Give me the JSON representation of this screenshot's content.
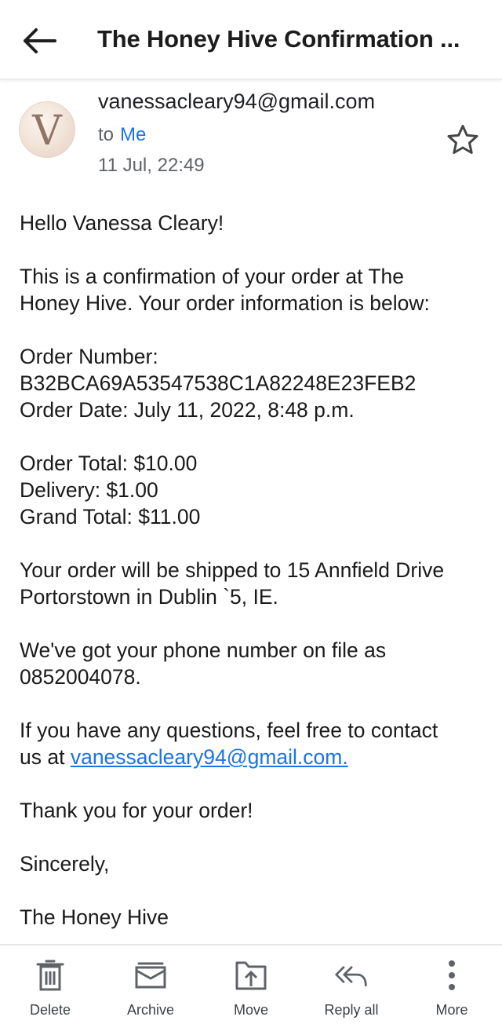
{
  "header": {
    "subject": "The Honey Hive Confirmation ...",
    "back_icon": "arrow-left-icon"
  },
  "message": {
    "avatar_letter": "V",
    "sender": "vanessacleary94@gmail.com",
    "to_label": "to",
    "recipient": "Me",
    "date": "11 Jul, 22:49",
    "star_icon": "star-outline-icon"
  },
  "body": {
    "greeting": "Hello Vanessa Cleary!",
    "intro_line1": "This is a confirmation of your order at The",
    "intro_line2": "Honey Hive. Your order information is below:",
    "order_number_label": "Order Number:",
    "order_number": "B32BCA69A53547538C1A82248E23FEB2",
    "order_date": "Order Date: July 11, 2022, 8:48 p.m.",
    "order_total": "Order Total: $10.00",
    "delivery": "Delivery: $1.00",
    "grand_total": "Grand Total: $11.00",
    "shipping_line1": "Your order will be shipped to 15 Annfield Drive",
    "shipping_line2": "Portorstown in Dublin `5, IE.",
    "phone_line1": "We've got your phone number on file as",
    "phone_line2": "0852004078.",
    "contact_line1": "If you have any questions, feel free to contact",
    "contact_prefix": "us at ",
    "contact_email": "vanessacleary94@gmail.com.",
    "thanks": "Thank you for your order!",
    "signoff": "Sincerely,",
    "signature": "The Honey Hive"
  },
  "actions": [
    {
      "label": "Delete",
      "icon": "trash-icon"
    },
    {
      "label": "Archive",
      "icon": "archive-icon"
    },
    {
      "label": "Move",
      "icon": "move-icon"
    },
    {
      "label": "Reply all",
      "icon": "reply-all-icon"
    },
    {
      "label": "More",
      "icon": "more-vertical-icon"
    }
  ],
  "colors": {
    "link": "#1a73e8",
    "text": "#1a1a1a",
    "muted": "#5f6368",
    "icon": "#5f6368"
  }
}
